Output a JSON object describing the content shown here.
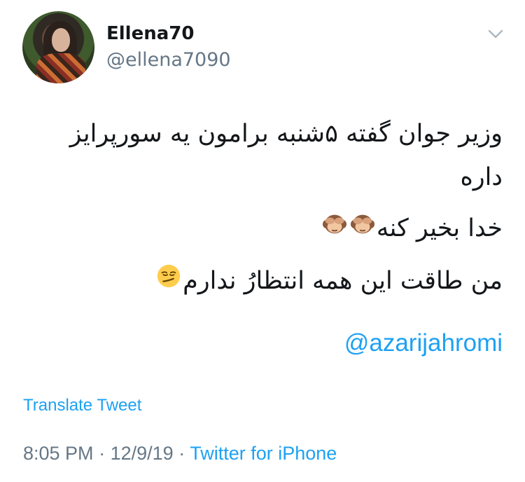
{
  "user": {
    "display_name": "Ellena70",
    "handle": "@ellena7090"
  },
  "tweet": {
    "lines": [
      "وزیر جوان گفته ۵شنبه برامون یه سورپرایز داره",
      "خدا بخیر کنه",
      "من طاقت این همه انتظارُ ندارم"
    ],
    "mention": "@azarijahromi",
    "translate_label": "Translate Tweet",
    "time": "8:05 PM",
    "date": "12/9/19",
    "separator": "·",
    "source": "Twitter for iPhone"
  },
  "icons": {
    "menu": "chevron-down-icon",
    "line2_emojis": [
      "see-no-evil-monkey-icon",
      "see-no-evil-monkey-icon"
    ],
    "line3_emoji": "smirking-face-icon"
  },
  "colors": {
    "text": "#14171a",
    "secondary": "#657786",
    "link": "#1da1f2",
    "background": "#ffffff"
  }
}
